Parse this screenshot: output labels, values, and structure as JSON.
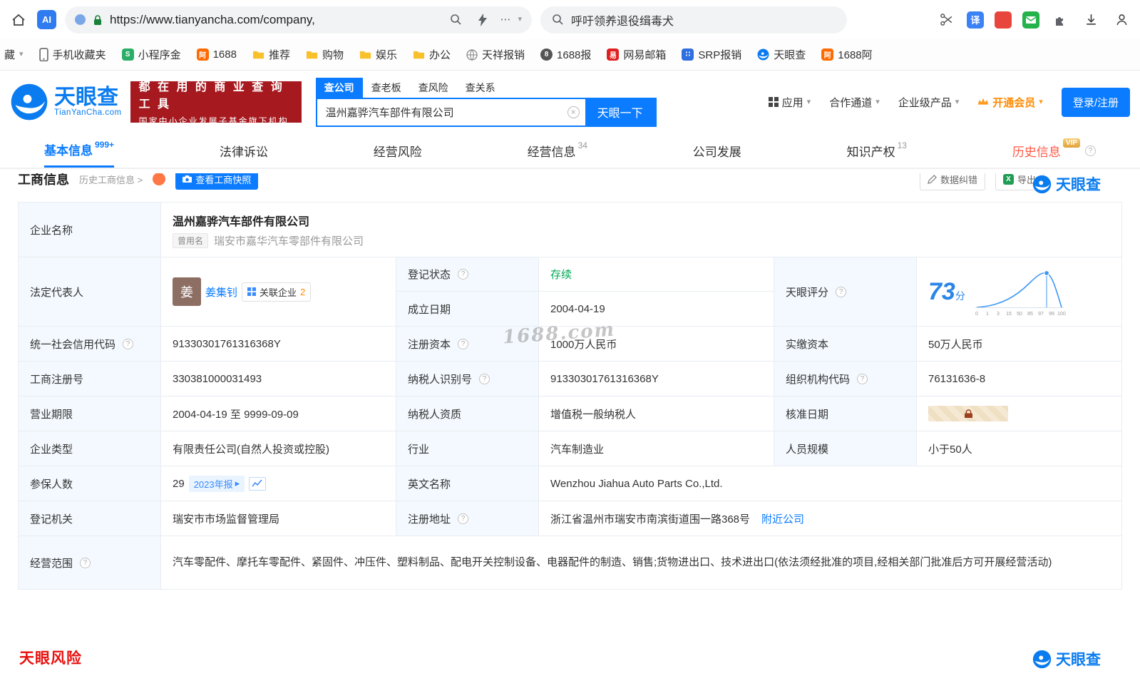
{
  "colors": {
    "accent": "#0b7cff",
    "logo": "#0a7cf0",
    "banner": "#a6191e",
    "green": "#00a854",
    "vip": "#ff8a00",
    "risk": "#e8110f"
  },
  "icons": {
    "chevron_down": "▾",
    "help": "?",
    "close": "×",
    "more": "⋯",
    "arrow_right": "▸",
    "history_arrow": ">"
  },
  "chrome": {
    "url": "https://www.tianyancha.com/company,",
    "search_query": "呼吁领养退役缉毒犬",
    "ai_label": "AI",
    "translate_label": "译"
  },
  "bookmarks": {
    "overflow_label": "藏",
    "items": [
      {
        "label": "手机收藏夹"
      },
      {
        "label": "小程序金"
      },
      {
        "label": "1688"
      },
      {
        "label": "推荐"
      },
      {
        "label": "购物"
      },
      {
        "label": "娱乐"
      },
      {
        "label": "办公"
      },
      {
        "label": "天祥报销"
      },
      {
        "label": "1688报"
      },
      {
        "label": "网易邮箱"
      },
      {
        "label": "SRP报销"
      },
      {
        "label": "天眼查"
      },
      {
        "label": "1688阿"
      }
    ]
  },
  "header": {
    "logo_text": "天眼查",
    "logo_sub": "TianYanCha.com",
    "banner_line1": "都 在 用 的 商 业 查 询 工 具",
    "banner_line2": "国家中小企业发展子基金旗下机构",
    "tabs": [
      {
        "label": "查公司"
      },
      {
        "label": "查老板"
      },
      {
        "label": "查风险"
      },
      {
        "label": "查关系"
      }
    ],
    "search_value": "温州嘉骅汽车部件有限公司",
    "search_button": "天眼一下",
    "menu_app": "应用",
    "menu_partner": "合作通道",
    "menu_enterprise": "企业级产品",
    "menu_vip": "开通会员",
    "login_button": "登录/注册"
  },
  "nav": {
    "tabs": [
      {
        "label": "基本信息",
        "badge": "999+"
      },
      {
        "label": "法律诉讼",
        "badge": ""
      },
      {
        "label": "经营风险",
        "badge": ""
      },
      {
        "label": "经营信息",
        "badge": "34"
      },
      {
        "label": "公司发展",
        "badge": ""
      },
      {
        "label": "知识产权",
        "badge": "13"
      },
      {
        "label": "历史信息",
        "badge": "VIP"
      }
    ]
  },
  "toolbar": {
    "title": "工商信息",
    "history_link": "历史工商信息",
    "snapshot_button": "查看工商快照",
    "correction_button": "数据纠错",
    "export_button": "导出"
  },
  "company": {
    "name_label": "企业名称",
    "name": "温州嘉骅汽车部件有限公司",
    "former_tag": "曾用名",
    "former_name": "瑞安市嘉华汽车零部件有限公司",
    "legal_rep_label": "法定代表人",
    "legal_rep_avatar": "姜",
    "legal_rep": "姜集钊",
    "related_label": "关联企业",
    "related_count": "2",
    "reg_status_label": "登记状态",
    "reg_status": "存续",
    "establish_label": "成立日期",
    "establish_date": "2004-04-19",
    "score_label": "天眼评分",
    "score": "73",
    "score_unit": "分",
    "credit_code_label": "统一社会信用代码",
    "credit_code": "91330301761316368Y",
    "reg_capital_label": "注册资本",
    "reg_capital": "1000万人民币",
    "paid_capital_label": "实缴资本",
    "paid_capital": "50万人民币",
    "reg_number_label": "工商注册号",
    "reg_number": "330381000031493",
    "taxpayer_id_label": "纳税人识别号",
    "taxpayer_id": "91330301761316368Y",
    "org_code_label": "组织机构代码",
    "org_code": "76131636-8",
    "term_label": "营业期限",
    "term": "2004-04-19 至 9999-09-09",
    "taxpayer_quality_label": "纳税人资质",
    "taxpayer_quality": "增值税一般纳税人",
    "approval_label": "核准日期",
    "type_label": "企业类型",
    "type": "有限责任公司(自然人投资或控股)",
    "industry_label": "行业",
    "industry": "汽车制造业",
    "staff_label": "人员规模",
    "staff": "小于50人",
    "insured_label": "参保人数",
    "insured": "29",
    "insured_badge": "2023年报",
    "english_label": "英文名称",
    "english_name": "Wenzhou Jiahua Auto Parts Co.,Ltd.",
    "authority_label": "登记机关",
    "authority": "瑞安市市场监督管理局",
    "address_label": "注册地址",
    "address": "浙江省温州市瑞安市南滨街道围一路368号",
    "nearby_link": "附近公司",
    "scope_label": "经营范围",
    "scope": "汽车零配件、摩托车零配件、紧固件、冲压件、塑料制品、配电开关控制设备、电器配件的制造、销售;货物进出口、技术进出口(依法须经批准的项目,经相关部门批准后方可开展经营活动)"
  },
  "score_chart": {
    "ticks": [
      "0",
      "1",
      "3",
      "15",
      "50",
      "85",
      "97",
      "99",
      "100"
    ]
  },
  "watermark": "1688.com",
  "footer": {
    "risk_title": "天眼风险",
    "brand": "天眼查"
  }
}
